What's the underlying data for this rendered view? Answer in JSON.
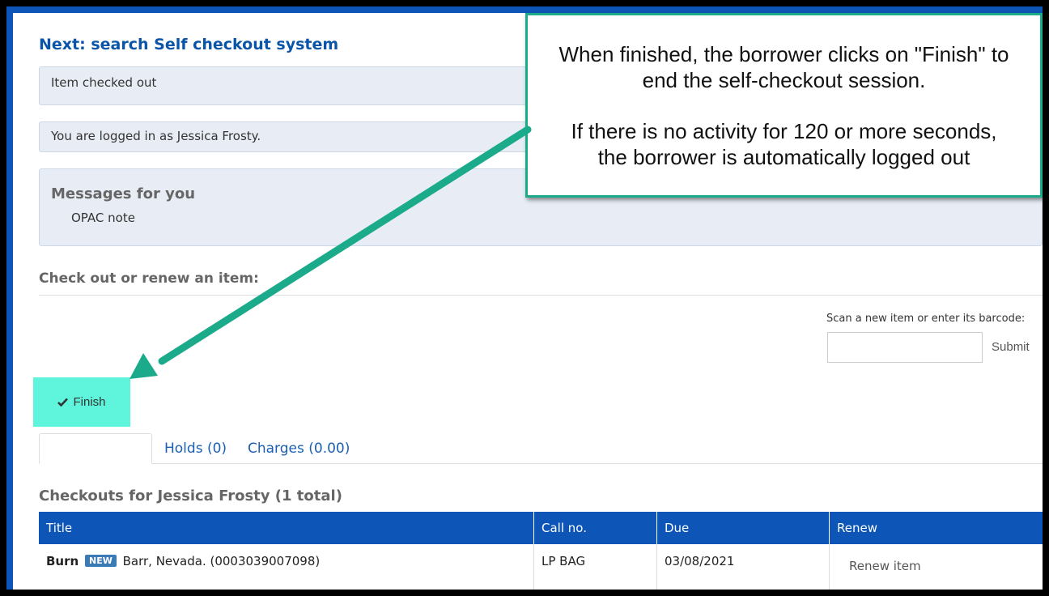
{
  "colors": {
    "brand_blue": "#0d55b6",
    "link_blue": "#1a5fb4",
    "finish_highlight": "#5ef5dc",
    "callout_border": "#1bab8a",
    "alert_bg": "#e8edf5"
  },
  "page_title": "Next: search Self checkout system",
  "alerts": {
    "checked_out": "Item checked out",
    "logged_in": "You are logged in as Jessica Frosty.",
    "messages_heading": "Messages for you",
    "messages_body": "OPAC note"
  },
  "checkout_form": {
    "heading": "Check out or renew an item:",
    "scan_label": "Scan a new item or enter its barcode:",
    "barcode_value": "",
    "submit_label": "Submit"
  },
  "finish_button": {
    "label": "Finish",
    "icon": "check-icon"
  },
  "tabs": {
    "active_label": "",
    "holds": "Holds (0)",
    "charges": "Charges (0.00)"
  },
  "checkouts": {
    "heading": "Checkouts for Jessica Frosty (1 total)",
    "columns": [
      "Title",
      "Call no.",
      "Due",
      "Renew"
    ],
    "rows": [
      {
        "title": "Burn",
        "badge": "NEW",
        "author_barcode": "Barr, Nevada. (0003039007098)",
        "call_no": "LP BAG",
        "due": "03/08/2021",
        "renew": "Renew item"
      }
    ]
  },
  "callout": {
    "line1": "When finished, the borrower clicks on \"Finish\" to",
    "line2": "end the self-checkout session.",
    "line3": "If there is no activity for 120 or more seconds,",
    "line4": "the borrower is automatically logged out"
  }
}
